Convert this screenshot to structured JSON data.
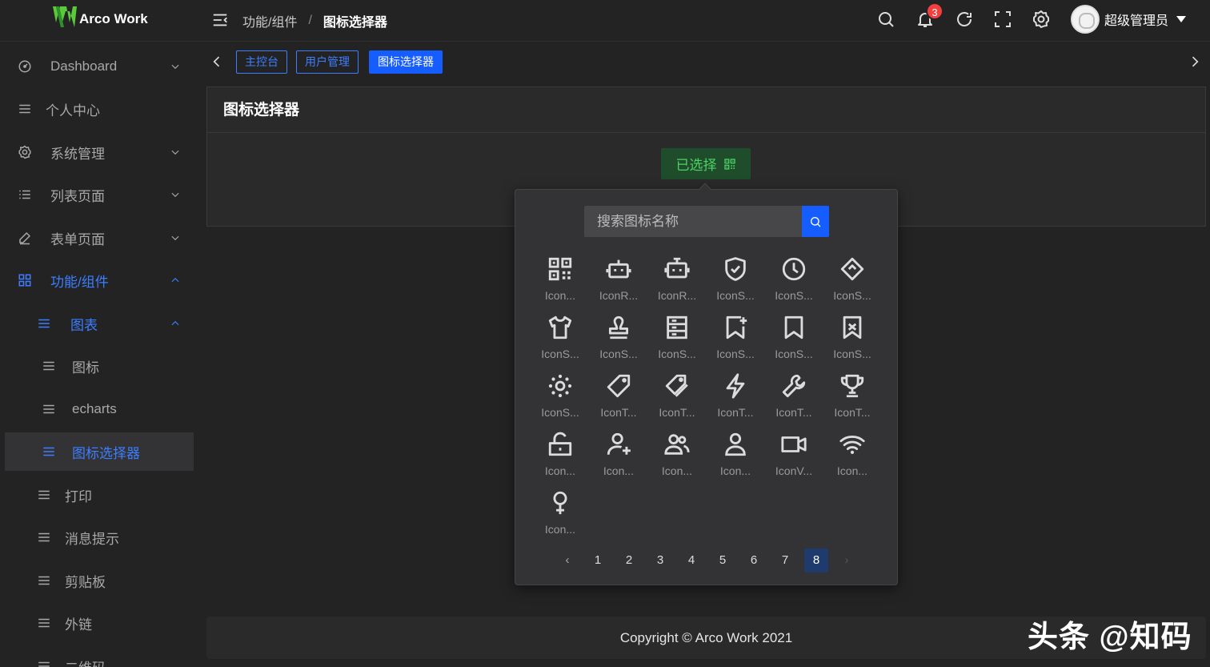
{
  "app": {
    "name": "Arco Work"
  },
  "header": {
    "breadcrumb": [
      "功能/组件",
      "/",
      "图标选择器"
    ],
    "notification_count": "3",
    "user_name": "超级管理员"
  },
  "sidebar": {
    "items": [
      {
        "label": "Dashboard"
      },
      {
        "label": "个人中心"
      },
      {
        "label": "系统管理"
      },
      {
        "label": "列表页面"
      },
      {
        "label": "表单页面"
      },
      {
        "label": "功能/组件"
      },
      {
        "label": "图表"
      },
      {
        "label": "图标"
      },
      {
        "label": "echarts"
      },
      {
        "label": "图标选择器"
      },
      {
        "label": "打印"
      },
      {
        "label": "消息提示"
      },
      {
        "label": "剪贴板"
      },
      {
        "label": "外链"
      },
      {
        "label": "二维码"
      }
    ]
  },
  "tabs": [
    {
      "label": "主控台"
    },
    {
      "label": "用户管理"
    },
    {
      "label": "图标选择器"
    }
  ],
  "card": {
    "title": "图标选择器"
  },
  "selector": {
    "button_label": "已选择",
    "search_placeholder": "搜索图标名称",
    "icons": [
      {
        "label": "Icon...",
        "icon": "qrcode-icon"
      },
      {
        "label": "IconR...",
        "icon": "robot-add-icon"
      },
      {
        "label": "IconR...",
        "icon": "robot-icon"
      },
      {
        "label": "IconS...",
        "icon": "safe-icon"
      },
      {
        "label": "IconS...",
        "icon": "schedule-icon"
      },
      {
        "label": "IconS...",
        "icon": "shake-icon"
      },
      {
        "label": "IconS...",
        "icon": "skin-icon"
      },
      {
        "label": "IconS...",
        "icon": "stamp-icon"
      },
      {
        "label": "IconS...",
        "icon": "storage-icon"
      },
      {
        "label": "IconS...",
        "icon": "subscribe-add-icon"
      },
      {
        "label": "IconS...",
        "icon": "subscribe-icon"
      },
      {
        "label": "IconS...",
        "icon": "subscribed-icon"
      },
      {
        "label": "IconS...",
        "icon": "sun-icon"
      },
      {
        "label": "IconT...",
        "icon": "tag-icon"
      },
      {
        "label": "IconT...",
        "icon": "tags-icon"
      },
      {
        "label": "IconT...",
        "icon": "thunderbolt-icon"
      },
      {
        "label": "IconT...",
        "icon": "tool-icon"
      },
      {
        "label": "IconT...",
        "icon": "trophy-icon"
      },
      {
        "label": "Icon...",
        "icon": "unlock-icon"
      },
      {
        "label": "Icon...",
        "icon": "user-add-icon"
      },
      {
        "label": "Icon...",
        "icon": "user-group-icon"
      },
      {
        "label": "Icon...",
        "icon": "user-icon"
      },
      {
        "label": "IconV...",
        "icon": "video-camera-icon"
      },
      {
        "label": "Icon...",
        "icon": "wifi-icon"
      },
      {
        "label": "Icon...",
        "icon": "woman-icon"
      }
    ],
    "pages": [
      "1",
      "2",
      "3",
      "4",
      "5",
      "6",
      "7",
      "8"
    ],
    "current_page": "8"
  },
  "footer": {
    "text": "Copyright © Arco Work 2021"
  },
  "watermark": {
    "text": "头条 @知码"
  },
  "colors": {
    "primary": "#165dff",
    "accent_link": "#3c7eff",
    "success": "#4cd263",
    "danger": "#f53f3f",
    "bg": "#232324"
  }
}
